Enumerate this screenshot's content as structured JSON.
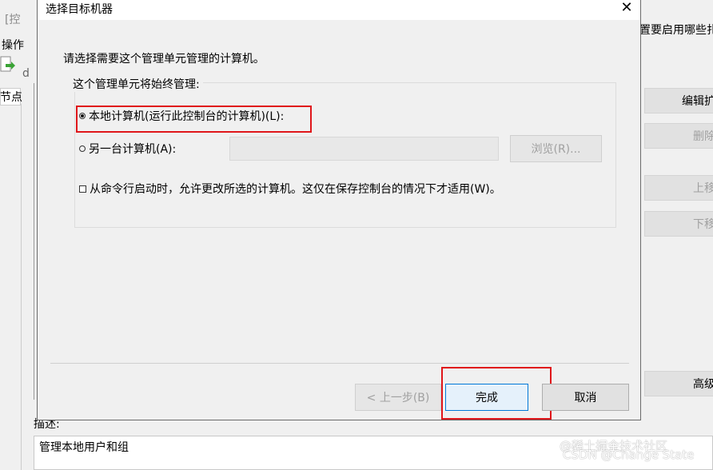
{
  "background": {
    "left": {
      "breadcrumb": "[控",
      "menu": "操作",
      "tree_label": "节点",
      "letter": "d"
    },
    "right": {
      "header_text": "置要启用哪些扎",
      "buttons": [
        {
          "label": "编辑扩",
          "disabled": false
        },
        {
          "label": "删除",
          "disabled": true
        },
        {
          "label": "上移",
          "disabled": true
        },
        {
          "label": "下移",
          "disabled": true
        },
        {
          "label": "高级",
          "disabled": false
        }
      ]
    },
    "description": {
      "label": "描述:",
      "text": "管理本地用户和组"
    }
  },
  "dialog": {
    "title": "选择目标机器",
    "close_glyph": "✕",
    "instruction": "请选择需要这个管理单元管理的计算机。",
    "group_label": "这个管理单元将始终管理:",
    "options": {
      "local": "本地计算机(运行此控制台的计算机)(L):",
      "other": "另一台计算机(A):",
      "other_value": "",
      "browse": "浏览(R)...",
      "checkbox": "从命令行启动时，允许更改所选的计算机。这仅在保存控制台的情况下才适用(W)。"
    },
    "buttons": {
      "back": "< 上一步(B)",
      "finish": "完成",
      "cancel": "取消"
    }
  },
  "watermark": {
    "line1": "@稀土掘金技术社区",
    "line2": "CSDN @Change State"
  },
  "colors": {
    "highlight": "#e0161a",
    "focus_blue": "#0078d7"
  }
}
